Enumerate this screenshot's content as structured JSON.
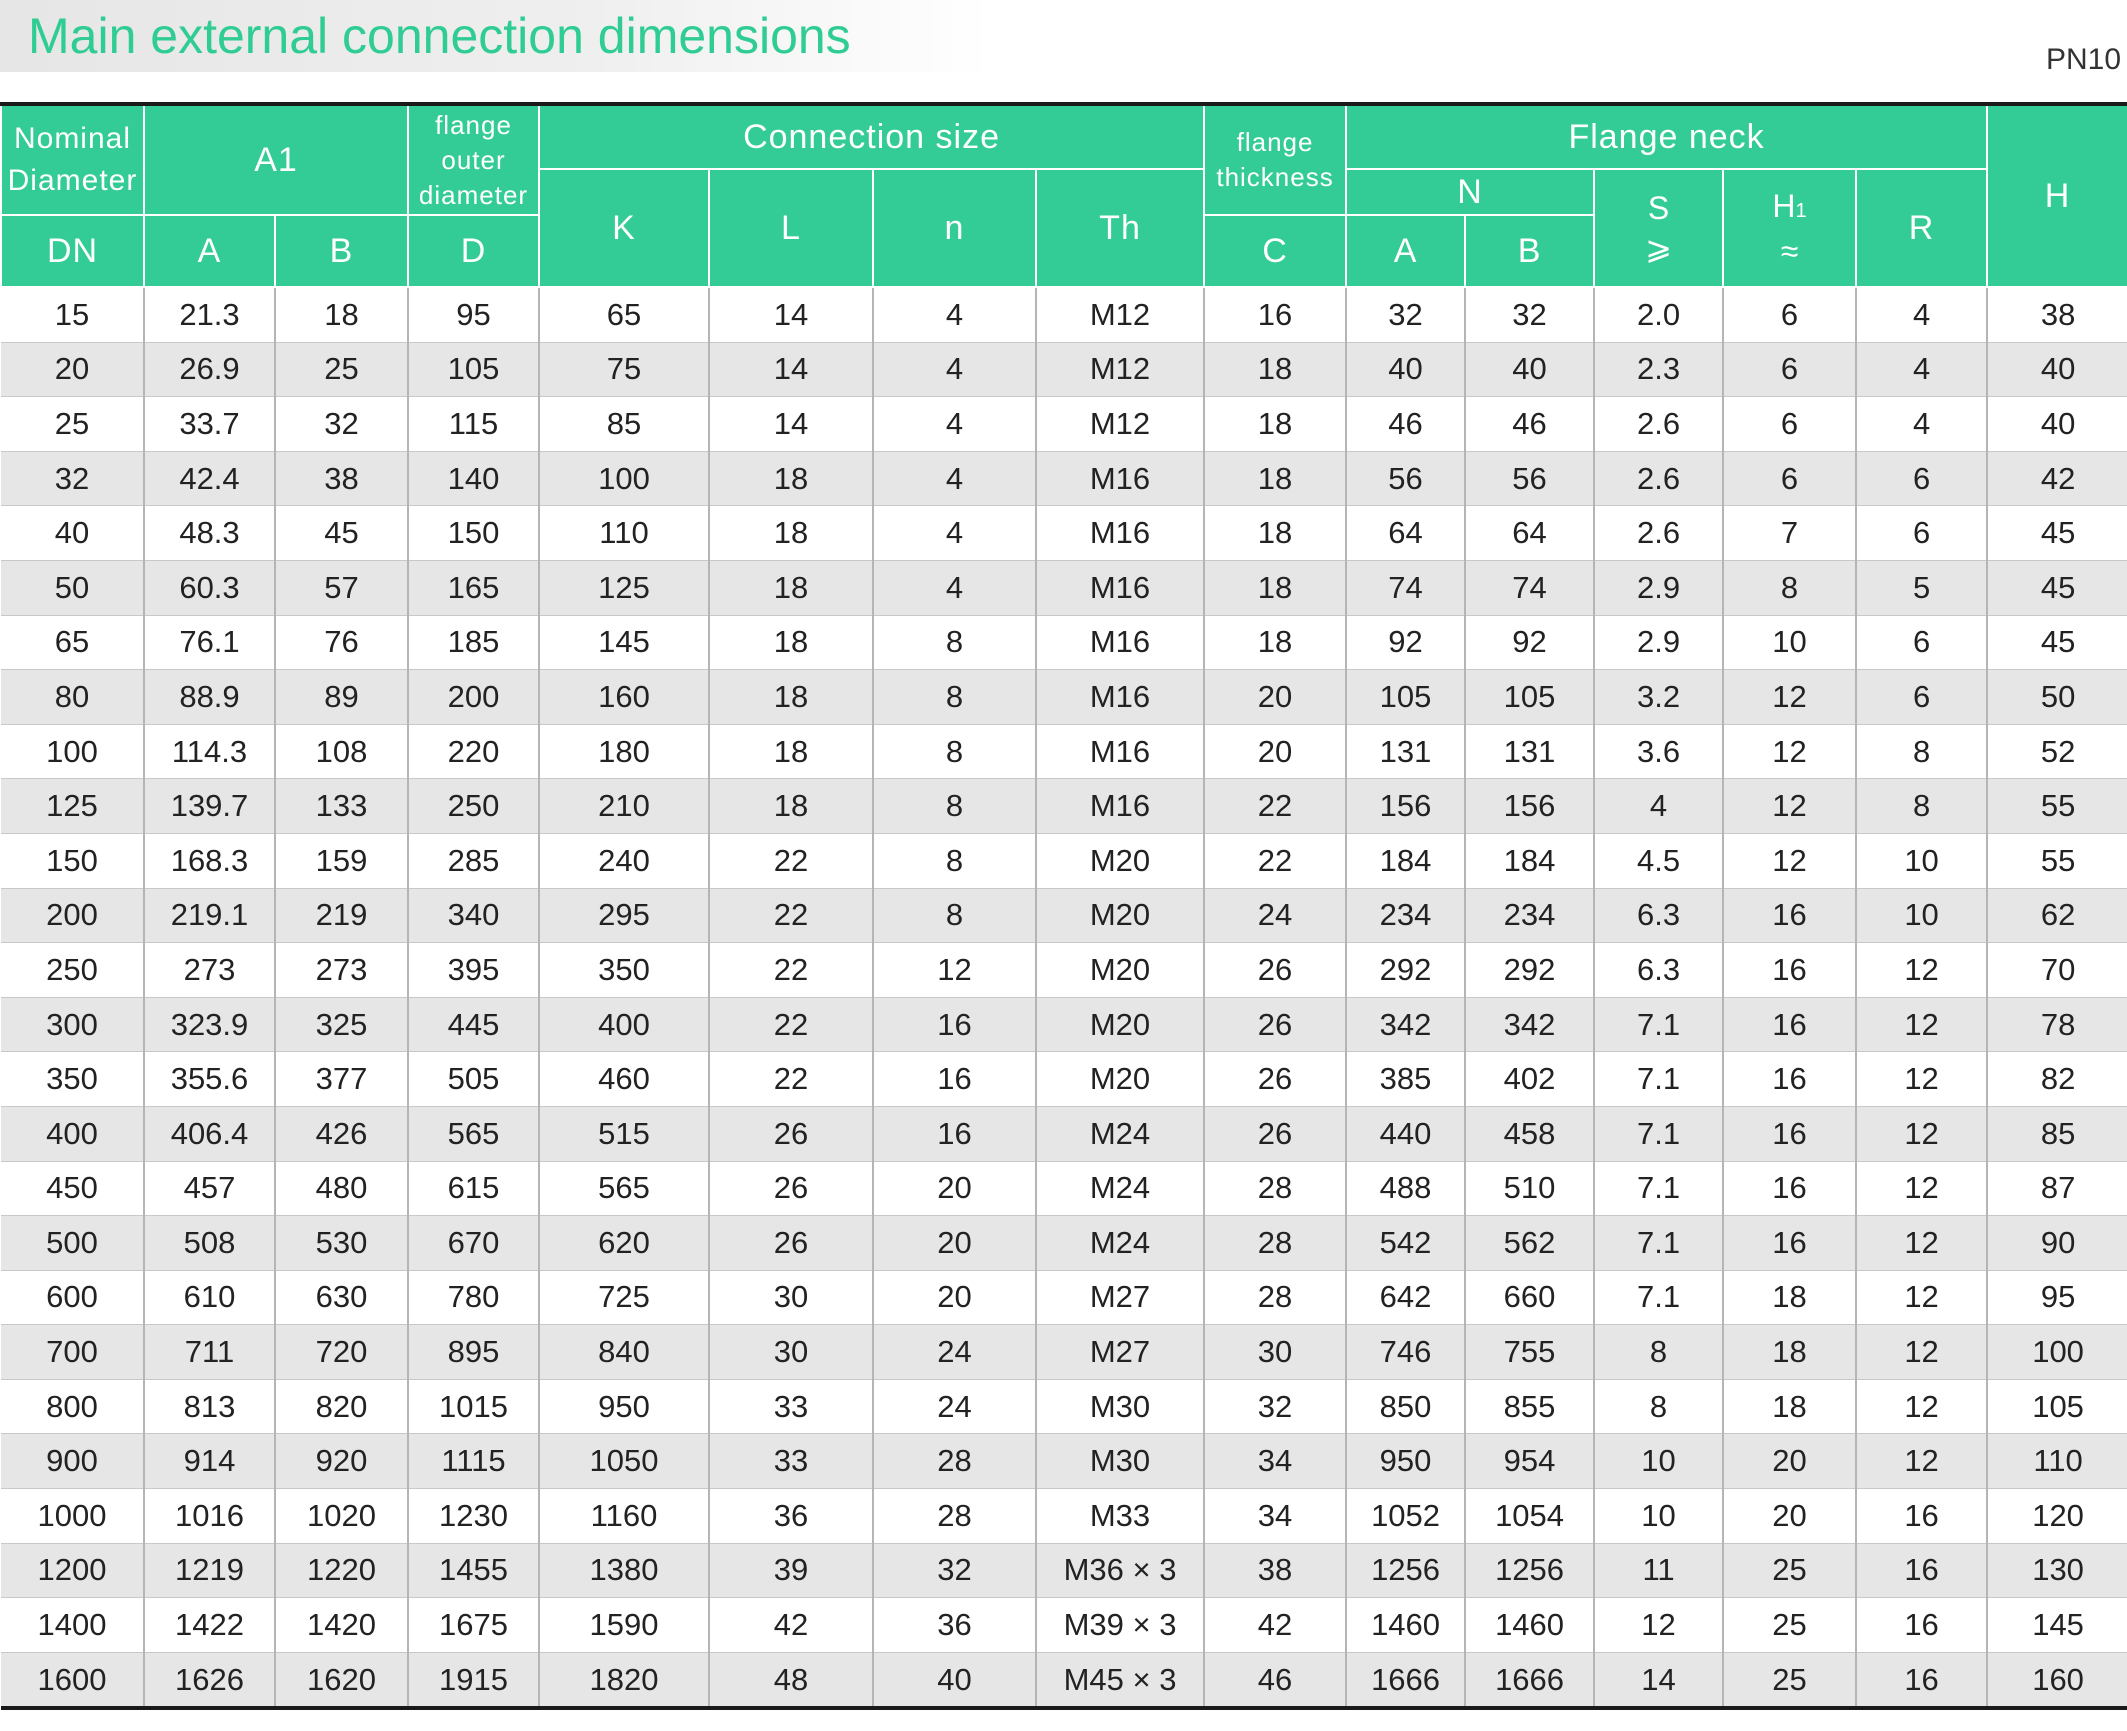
{
  "header": {
    "title": "Main external connection dimensions",
    "pressure_class": "PN10"
  },
  "table": {
    "headers": {
      "nominal_diameter": [
        "Nominal",
        "Diameter"
      ],
      "dn": "DN",
      "a1": "A1",
      "a1_a": "A",
      "a1_b": "B",
      "flange_outer_diameter": [
        "flange",
        "outer",
        "diameter"
      ],
      "d": "D",
      "connection_size": "Connection size",
      "k": "K",
      "l": "L",
      "n_count": "n",
      "th": "Th",
      "flange_thickness": [
        "flange",
        "thickness"
      ],
      "c": "C",
      "flange_neck": "Flange neck",
      "neck_n": "N",
      "neck_a": "A",
      "neck_b": "B",
      "s": "S",
      "s_sym": "⩾",
      "h1_main": "H",
      "h1_sub": "1",
      "h1_sym": "≈",
      "r": "R",
      "h": "H"
    },
    "rows": [
      [
        "15",
        "21.3",
        "18",
        "95",
        "65",
        "14",
        "4",
        "M12",
        "16",
        "32",
        "32",
        "2.0",
        "6",
        "4",
        "38"
      ],
      [
        "20",
        "26.9",
        "25",
        "105",
        "75",
        "14",
        "4",
        "M12",
        "18",
        "40",
        "40",
        "2.3",
        "6",
        "4",
        "40"
      ],
      [
        "25",
        "33.7",
        "32",
        "115",
        "85",
        "14",
        "4",
        "M12",
        "18",
        "46",
        "46",
        "2.6",
        "6",
        "4",
        "40"
      ],
      [
        "32",
        "42.4",
        "38",
        "140",
        "100",
        "18",
        "4",
        "M16",
        "18",
        "56",
        "56",
        "2.6",
        "6",
        "6",
        "42"
      ],
      [
        "40",
        "48.3",
        "45",
        "150",
        "110",
        "18",
        "4",
        "M16",
        "18",
        "64",
        "64",
        "2.6",
        "7",
        "6",
        "45"
      ],
      [
        "50",
        "60.3",
        "57",
        "165",
        "125",
        "18",
        "4",
        "M16",
        "18",
        "74",
        "74",
        "2.9",
        "8",
        "5",
        "45"
      ],
      [
        "65",
        "76.1",
        "76",
        "185",
        "145",
        "18",
        "8",
        "M16",
        "18",
        "92",
        "92",
        "2.9",
        "10",
        "6",
        "45"
      ],
      [
        "80",
        "88.9",
        "89",
        "200",
        "160",
        "18",
        "8",
        "M16",
        "20",
        "105",
        "105",
        "3.2",
        "12",
        "6",
        "50"
      ],
      [
        "100",
        "114.3",
        "108",
        "220",
        "180",
        "18",
        "8",
        "M16",
        "20",
        "131",
        "131",
        "3.6",
        "12",
        "8",
        "52"
      ],
      [
        "125",
        "139.7",
        "133",
        "250",
        "210",
        "18",
        "8",
        "M16",
        "22",
        "156",
        "156",
        "4",
        "12",
        "8",
        "55"
      ],
      [
        "150",
        "168.3",
        "159",
        "285",
        "240",
        "22",
        "8",
        "M20",
        "22",
        "184",
        "184",
        "4.5",
        "12",
        "10",
        "55"
      ],
      [
        "200",
        "219.1",
        "219",
        "340",
        "295",
        "22",
        "8",
        "M20",
        "24",
        "234",
        "234",
        "6.3",
        "16",
        "10",
        "62"
      ],
      [
        "250",
        "273",
        "273",
        "395",
        "350",
        "22",
        "12",
        "M20",
        "26",
        "292",
        "292",
        "6.3",
        "16",
        "12",
        "70"
      ],
      [
        "300",
        "323.9",
        "325",
        "445",
        "400",
        "22",
        "16",
        "M20",
        "26",
        "342",
        "342",
        "7.1",
        "16",
        "12",
        "78"
      ],
      [
        "350",
        "355.6",
        "377",
        "505",
        "460",
        "22",
        "16",
        "M20",
        "26",
        "385",
        "402",
        "7.1",
        "16",
        "12",
        "82"
      ],
      [
        "400",
        "406.4",
        "426",
        "565",
        "515",
        "26",
        "16",
        "M24",
        "26",
        "440",
        "458",
        "7.1",
        "16",
        "12",
        "85"
      ],
      [
        "450",
        "457",
        "480",
        "615",
        "565",
        "26",
        "20",
        "M24",
        "28",
        "488",
        "510",
        "7.1",
        "16",
        "12",
        "87"
      ],
      [
        "500",
        "508",
        "530",
        "670",
        "620",
        "26",
        "20",
        "M24",
        "28",
        "542",
        "562",
        "7.1",
        "16",
        "12",
        "90"
      ],
      [
        "600",
        "610",
        "630",
        "780",
        "725",
        "30",
        "20",
        "M27",
        "28",
        "642",
        "660",
        "7.1",
        "18",
        "12",
        "95"
      ],
      [
        "700",
        "711",
        "720",
        "895",
        "840",
        "30",
        "24",
        "M27",
        "30",
        "746",
        "755",
        "8",
        "18",
        "12",
        "100"
      ],
      [
        "800",
        "813",
        "820",
        "1015",
        "950",
        "33",
        "24",
        "M30",
        "32",
        "850",
        "855",
        "8",
        "18",
        "12",
        "105"
      ],
      [
        "900",
        "914",
        "920",
        "1115",
        "1050",
        "33",
        "28",
        "M30",
        "34",
        "950",
        "954",
        "10",
        "20",
        "12",
        "110"
      ],
      [
        "1000",
        "1016",
        "1020",
        "1230",
        "1160",
        "36",
        "28",
        "M33",
        "34",
        "1052",
        "1054",
        "10",
        "20",
        "16",
        "120"
      ],
      [
        "1200",
        "1219",
        "1220",
        "1455",
        "1380",
        "39",
        "32",
        "M36 × 3",
        "38",
        "1256",
        "1256",
        "11",
        "25",
        "16",
        "130"
      ],
      [
        "1400",
        "1422",
        "1420",
        "1675",
        "1590",
        "42",
        "36",
        "M39 × 3",
        "42",
        "1460",
        "1460",
        "12",
        "25",
        "16",
        "145"
      ],
      [
        "1600",
        "1626",
        "1620",
        "1915",
        "1820",
        "48",
        "40",
        "M45 × 3",
        "46",
        "1666",
        "1666",
        "14",
        "25",
        "16",
        "160"
      ]
    ]
  }
}
